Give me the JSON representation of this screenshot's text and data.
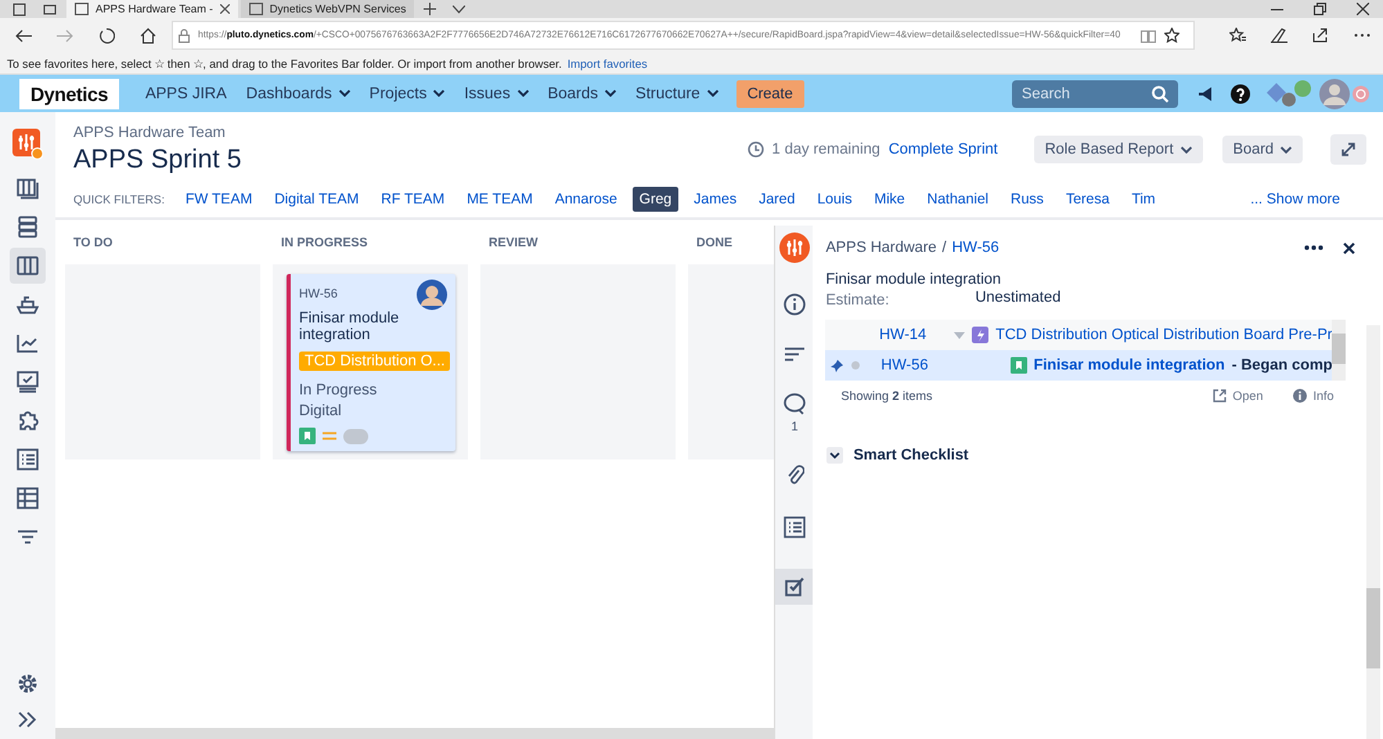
{
  "browser": {
    "tabs": [
      {
        "title": "APPS Hardware Team -",
        "selected": true
      },
      {
        "title": "Dynetics WebVPN Services",
        "selected": false
      }
    ],
    "url": "https://**pluto.dynetics.com**/+CSCO+0075676763663A2F2F7776656E2D746A72732E76612E716C6172677670662E70627A++/secure/RapidBoard.jspa?rapidView=4&view=detail&selectedIssue=HW-56&quickFilter=40",
    "favorites_message": "To see favorites here, select ☆ then ☆, and drag to the Favorites Bar folder. Or import from another browser.",
    "favorites_link": "Import favorites"
  },
  "header": {
    "logo": "Dynetics",
    "app": "APPS JIRA",
    "menus": [
      {
        "label": "Dashboards"
      },
      {
        "label": "Projects"
      },
      {
        "label": "Issues"
      },
      {
        "label": "Boards"
      },
      {
        "label": "Structure"
      }
    ],
    "create": "Create",
    "search_placeholder": "Search"
  },
  "sidebar": {
    "items": [
      {
        "kind": "backlog",
        "selected": false
      },
      {
        "kind": "stack",
        "selected": false
      },
      {
        "kind": "board",
        "selected": true
      },
      {
        "kind": "ship",
        "selected": false
      },
      {
        "kind": "reports",
        "selected": false
      },
      {
        "kind": "monitor",
        "selected": false
      },
      {
        "kind": "puzzle",
        "selected": false
      },
      {
        "kind": "checklist",
        "selected": false
      },
      {
        "kind": "table",
        "selected": false
      },
      {
        "kind": "filter",
        "selected": false
      }
    ]
  },
  "page": {
    "breadcrumb": "APPS Hardware Team",
    "title": "APPS Sprint 5",
    "remaining": "1 day remaining",
    "complete": "Complete Sprint",
    "buttons": [
      {
        "label": "Role Based Report"
      },
      {
        "label": "Board"
      }
    ],
    "quick_filters_label": "QUICK FILTERS:",
    "quick_filters": [
      {
        "label": "FW TEAM",
        "selected": false
      },
      {
        "label": "Digital TEAM",
        "selected": false
      },
      {
        "label": "RF TEAM",
        "selected": false
      },
      {
        "label": "ME TEAM",
        "selected": false
      },
      {
        "label": "Annarose",
        "selected": false
      },
      {
        "label": "Greg",
        "selected": true
      },
      {
        "label": "James",
        "selected": false
      },
      {
        "label": "Jared",
        "selected": false
      },
      {
        "label": "Louis",
        "selected": false
      },
      {
        "label": "Mike",
        "selected": false
      },
      {
        "label": "Nathaniel",
        "selected": false
      },
      {
        "label": "Russ",
        "selected": false
      },
      {
        "label": "Teresa",
        "selected": false
      },
      {
        "label": "Tim",
        "selected": false
      }
    ],
    "show_more": "... Show more"
  },
  "columns": [
    {
      "title": "TO DO"
    },
    {
      "title": "IN PROGRESS",
      "cards": [
        {
          "key": "HW-56",
          "summary": "Finisar module integration",
          "epic": "TCD Distribution O...",
          "status": "In Progress",
          "component": "Digital"
        }
      ]
    },
    {
      "title": "REVIEW"
    },
    {
      "title": "DONE"
    }
  ],
  "detail": {
    "project": "APPS Hardware",
    "separator": "/",
    "key": "HW-56",
    "summary": "Finisar module integration",
    "estimate_label": "Estimate:",
    "estimate": "Unestimated",
    "links": [
      {
        "key": "HW-14",
        "kind": "epic",
        "summary": "TCD Distribution Optical Distribution Board Pre-Pr",
        "selected": false
      },
      {
        "key": "HW-56",
        "kind": "story",
        "summary": "Finisar module integration",
        "note": "-  Began comp",
        "selected": true
      }
    ],
    "showing": "Showing **2** items",
    "open": "Open",
    "info": "Info",
    "comments": "1",
    "checklist": "Smart Checklist"
  }
}
